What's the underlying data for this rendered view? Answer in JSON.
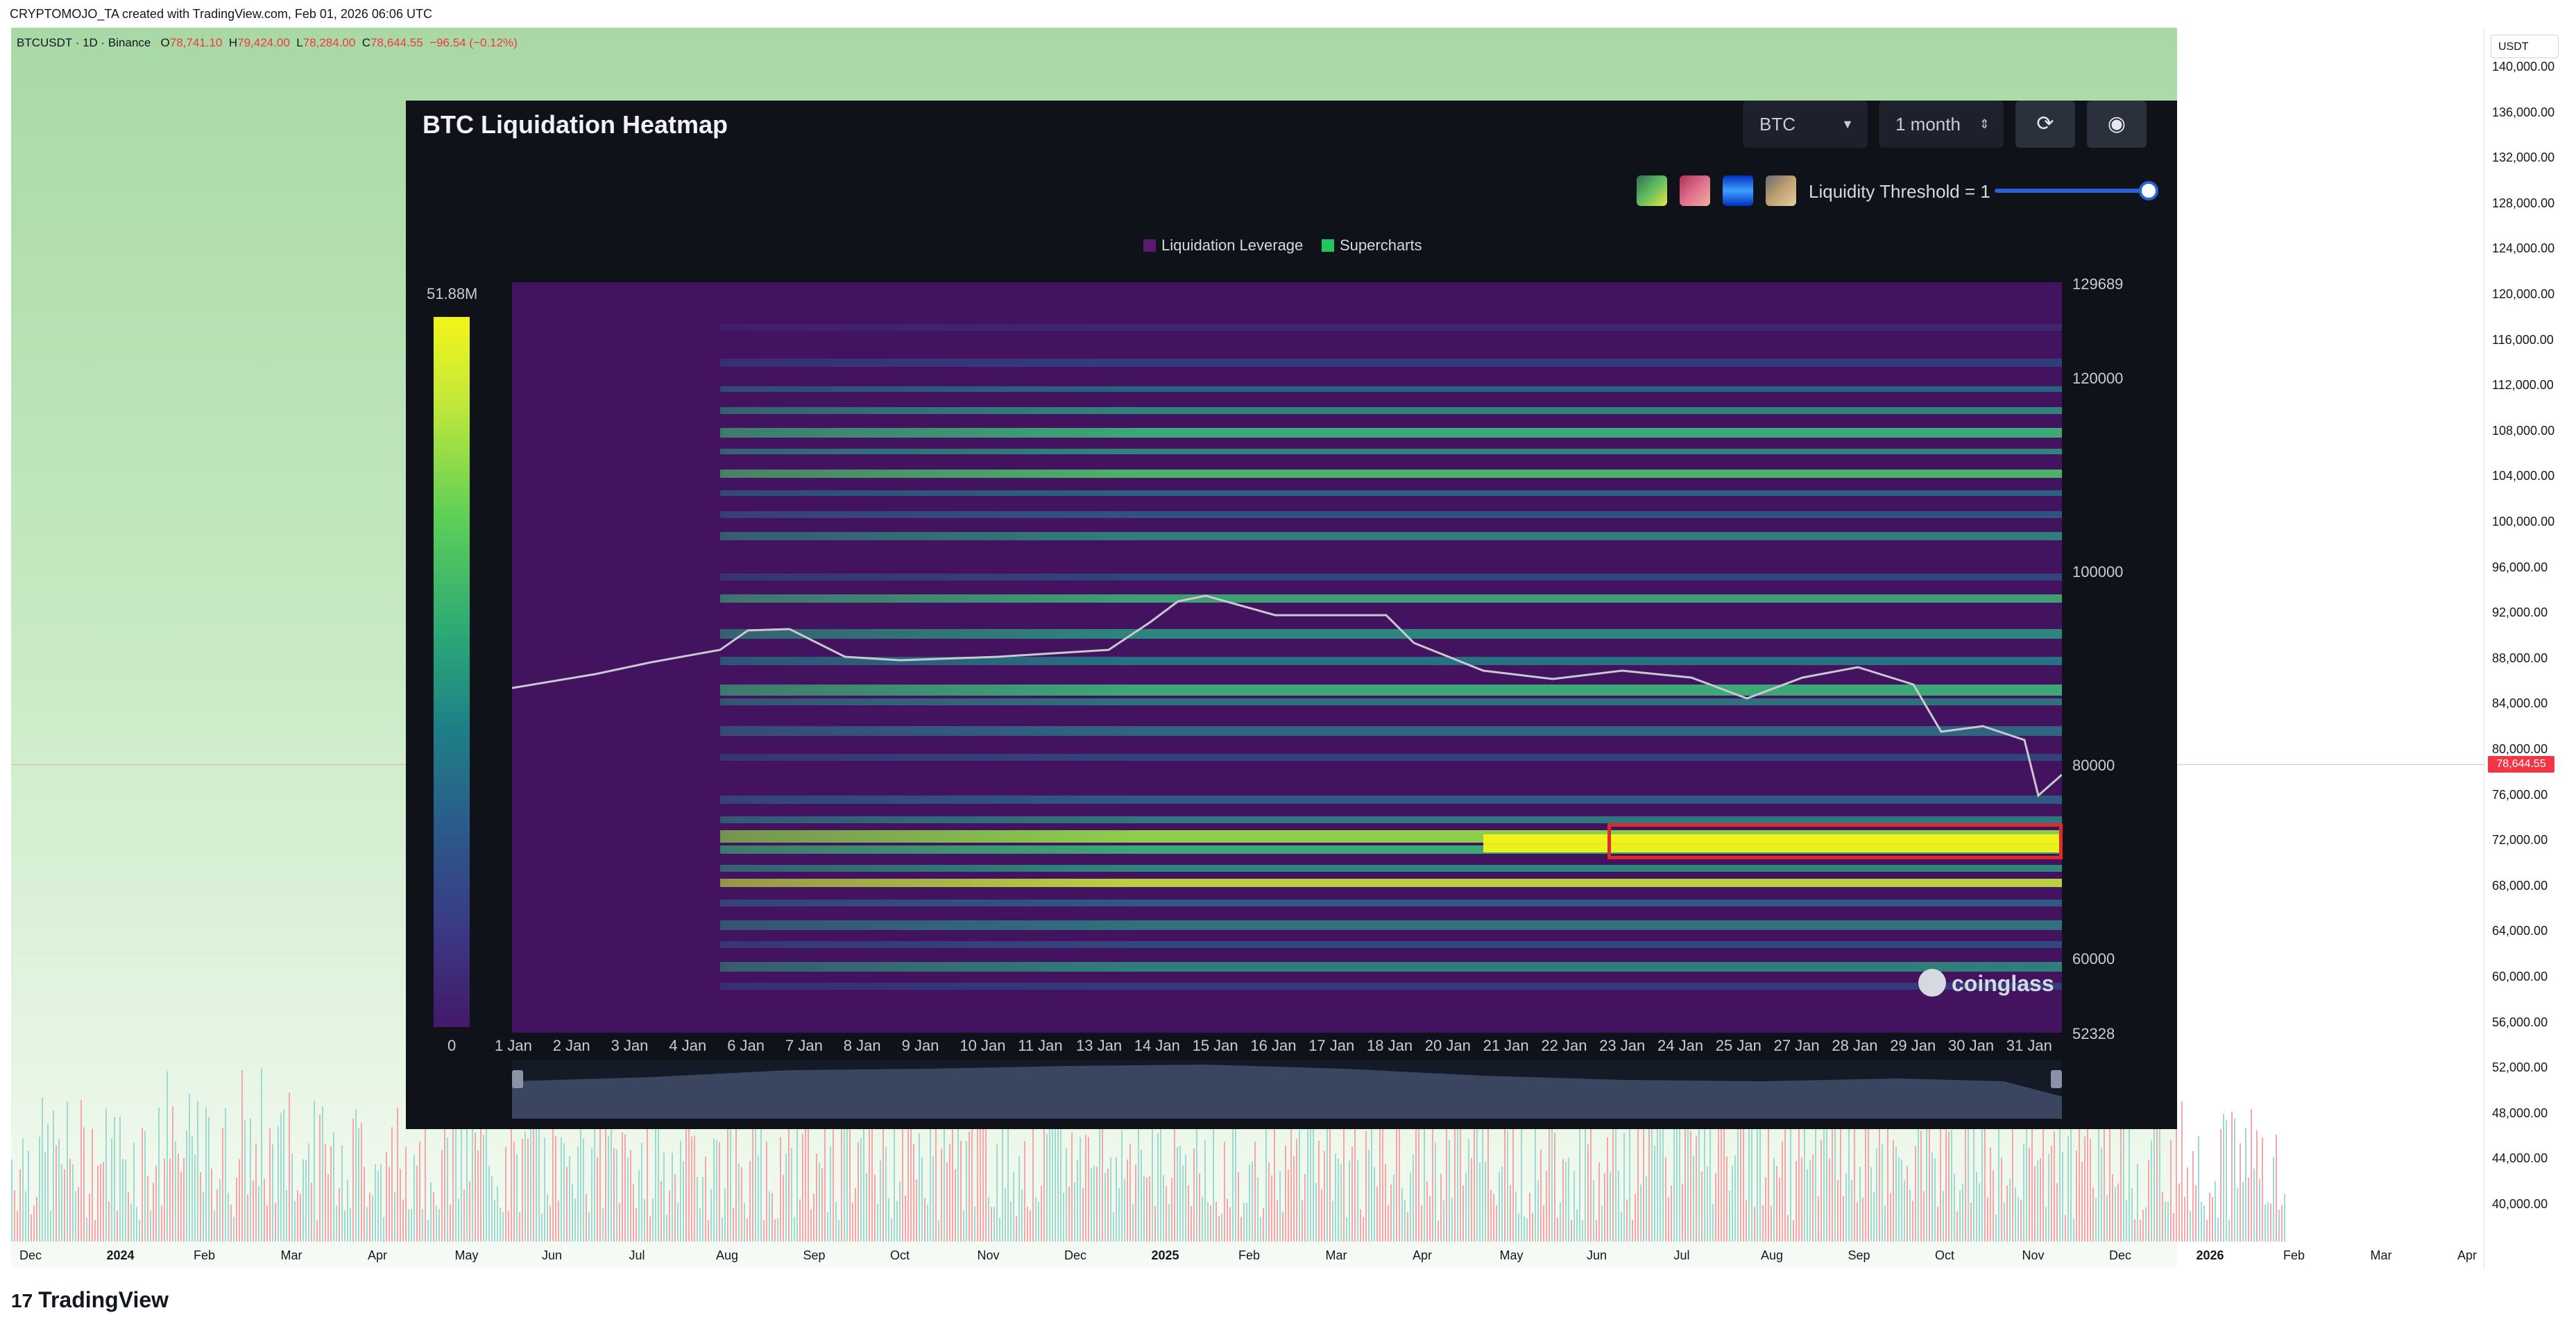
{
  "header": {
    "credit": "CRYPTOMOJO_TA created with TradingView.com, Feb 01, 2026 06:06 UTC"
  },
  "symbol": {
    "label": "BTCUSDT · 1D · Binance",
    "open_prefix": "O",
    "open": "78,741.10",
    "high_prefix": "H",
    "high": "79,424.00",
    "low_prefix": "L",
    "low": "78,284.00",
    "close_prefix": "C",
    "close": "78,644.55",
    "change": "−96.54 (−0.12%)"
  },
  "price_axis": {
    "currency": "USDT",
    "ticks": [
      "140,000.00",
      "136,000.00",
      "132,000.00",
      "128,000.00",
      "124,000.00",
      "120,000.00",
      "116,000.00",
      "112,000.00",
      "108,000.00",
      "104,000.00",
      "100,000.00",
      "96,000.00",
      "92,000.00",
      "88,000.00",
      "84,000.00",
      "80,000.00",
      "76,000.00",
      "72,000.00",
      "68,000.00",
      "64,000.00",
      "60,000.00",
      "56,000.00",
      "52,000.00",
      "48,000.00",
      "44,000.00",
      "40,000.00"
    ],
    "current_price": "78,644.55"
  },
  "time_axis": {
    "ticks": [
      "Dec",
      "2024",
      "Feb",
      "Mar",
      "Apr",
      "May",
      "Jun",
      "Jul",
      "Aug",
      "Sep",
      "Oct",
      "Nov",
      "Dec",
      "2025",
      "Feb",
      "Mar",
      "Apr",
      "May",
      "Jun",
      "Jul",
      "Aug",
      "Sep",
      "Oct",
      "Nov",
      "Dec",
      "2026",
      "Feb",
      "Mar",
      "Apr"
    ],
    "year_ticks": [
      "2024",
      "2025",
      "2026"
    ]
  },
  "branding": {
    "logo": "TradingView",
    "logo_mark": "17"
  },
  "heatmap_panel": {
    "title": "BTC Liquidation Heatmap",
    "coin_select": "BTC",
    "range_select": "1 month",
    "refresh_icon": "refresh-icon",
    "camera_icon": "camera-icon",
    "threshold_label": "Liquidity Threshold = 1",
    "legend": [
      {
        "label": "Liquidation Leverage",
        "color": "#5b1a6e"
      },
      {
        "label": "Supercharts",
        "color": "#22c55e"
      }
    ],
    "colorbar": {
      "max_label": "51.88M",
      "min_label": "0"
    },
    "price_ticks": [
      "129689",
      "120000",
      "100000",
      "80000",
      "60000",
      "52328"
    ],
    "dates": [
      "1 Jan",
      "2 Jan",
      "3 Jan",
      "4 Jan",
      "6 Jan",
      "7 Jan",
      "8 Jan",
      "9 Jan",
      "10 Jan",
      "11 Jan",
      "13 Jan",
      "14 Jan",
      "15 Jan",
      "16 Jan",
      "17 Jan",
      "18 Jan",
      "20 Jan",
      "21 Jan",
      "22 Jan",
      "23 Jan",
      "24 Jan",
      "25 Jan",
      "27 Jan",
      "28 Jan",
      "29 Jan",
      "30 Jan",
      "31 Jan"
    ],
    "watermark": "coinglass",
    "colors": {
      "background": "#0f1218",
      "heat_low": "#44135f",
      "heat_high": "#f3f518",
      "highlight": "#e32a2a"
    }
  }
}
